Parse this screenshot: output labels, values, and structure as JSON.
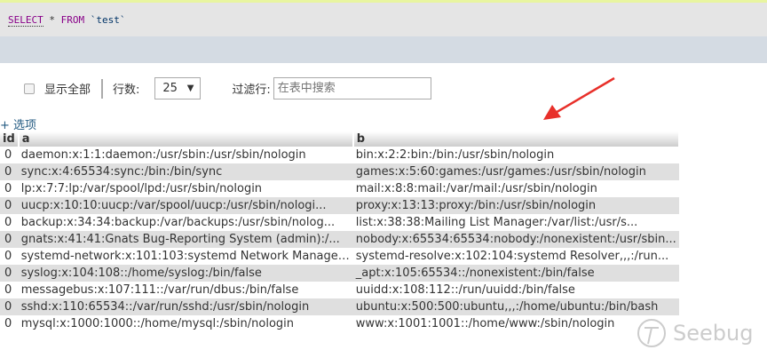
{
  "sql": {
    "select": "SELECT",
    "star": "*",
    "from": "FROM",
    "table": "`test`"
  },
  "controls": {
    "show_all": "显示全部",
    "rows_label": "行数:",
    "rows_value": "25",
    "filter_label": "过滤行:",
    "filter_placeholder": "在表中搜索"
  },
  "options_label": "+ 选项",
  "columns": [
    "id",
    "a",
    "b"
  ],
  "rows": [
    [
      "0",
      "daemon:x:1:1:daemon:/usr/sbin:/usr/sbin/nologin",
      "bin:x:2:2:bin:/bin:/usr/sbin/nologin"
    ],
    [
      "0",
      "sync:x:4:65534:sync:/bin:/bin/sync",
      "games:x:5:60:games:/usr/games:/usr/sbin/nologin"
    ],
    [
      "0",
      "lp:x:7:7:lp:/var/spool/lpd:/usr/sbin/nologin",
      "mail:x:8:8:mail:/var/mail:/usr/sbin/nologin"
    ],
    [
      "0",
      "uucp:x:10:10:uucp:/var/spool/uucp:/usr/sbin/nologi...",
      "proxy:x:13:13:proxy:/bin:/usr/sbin/nologin"
    ],
    [
      "0",
      "backup:x:34:34:backup:/var/backups:/usr/sbin/nolog...",
      "list:x:38:38:Mailing List Manager:/var/list:/usr/s..."
    ],
    [
      "0",
      "gnats:x:41:41:Gnats Bug-Reporting System (admin):/...",
      "nobody:x:65534:65534:nobody:/nonexistent:/usr/sbin..."
    ],
    [
      "0",
      "systemd-network:x:101:103:systemd Network Manageme...",
      "systemd-resolve:x:102:104:systemd Resolver,,,:/run..."
    ],
    [
      "0",
      "syslog:x:104:108::/home/syslog:/bin/false",
      "_apt:x:105:65534::/nonexistent:/bin/false"
    ],
    [
      "0",
      "messagebus:x:107:111::/var/run/dbus:/bin/false",
      "uuidd:x:108:112::/run/uuidd:/bin/false"
    ],
    [
      "0",
      "sshd:x:110:65534::/var/run/sshd:/usr/sbin/nologin",
      "ubuntu:x:500:500:ubuntu,,,:/home/ubuntu:/bin/bash"
    ],
    [
      "0",
      "mysql:x:1000:1000::/home/mysql:/sbin/nologin",
      "www:x:1001:1001::/home/www:/sbin/nologin"
    ]
  ],
  "watermark": "Seebug",
  "colors": {
    "arrow": "#e8302a",
    "keyword": "#880088",
    "band": "#d4dbe3"
  }
}
